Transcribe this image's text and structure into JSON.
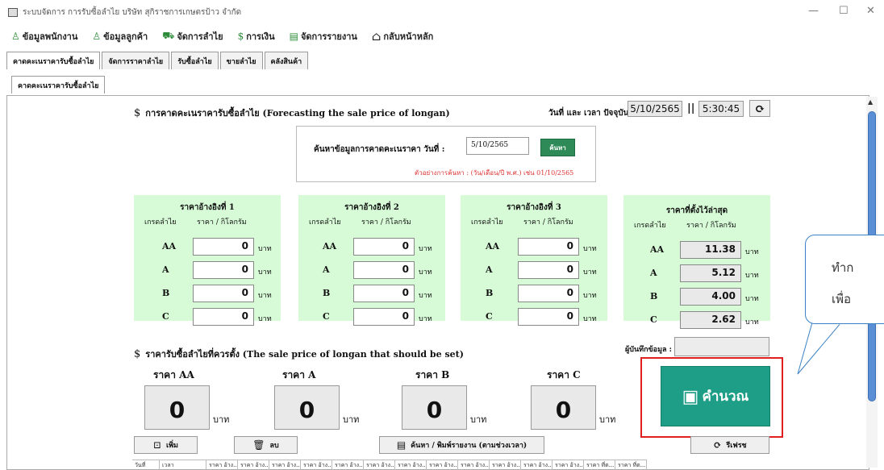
{
  "window": {
    "title": "ระบบจัดการ การรับซื้อลำไย บริษัท สุกิราชการเกษตรป้าว จำกัด",
    "minimize": "—",
    "maximize": "☐",
    "close": "✕"
  },
  "menu": [
    {
      "label": "ข้อมูลพนักงาน",
      "icon": "users-icon",
      "glyph": "♙"
    },
    {
      "label": "ข้อมูลลูกค้า",
      "icon": "customers-icon",
      "glyph": "♙"
    },
    {
      "label": "จัดการลำไย",
      "icon": "cart-icon",
      "glyph": "⛟"
    },
    {
      "label": "การเงิน",
      "icon": "dollar-icon",
      "glyph": "$"
    },
    {
      "label": "จัดการรายงาน",
      "icon": "report-icon",
      "glyph": "▤"
    },
    {
      "label": "กลับหน้าหลัก",
      "icon": "home-icon",
      "glyph": "⌂"
    }
  ],
  "tabs": [
    "คาดคะเนราคารับซื้อลำไย",
    "จัดการราคาลำไย",
    "รับซื้อลำไย",
    "ขายลำไย",
    "คลังสินค้า"
  ],
  "subtab": "คาดคะเนราคารับซื้อลำไย",
  "forecast": {
    "title": "การคาดคะเนราคารับซื้อลำไย (Forecasting the sale price of longan)",
    "datetime_label": "วันที่ และ เวลา ปัจจุบัน :",
    "date": "5/10/2565",
    "separator": "||",
    "time": "5:30:45"
  },
  "search": {
    "label": "ค้นหาข้อมูลการคาดคะเนราคา   วันที่ :",
    "value": "5/10/2565",
    "button": "ค้นหา",
    "hint": "ตัวอย่างการค้นหา : (วัน/เดือน/ปี พ.ศ.) เช่น 01/10/2565"
  },
  "ref_cards": [
    {
      "title": "ราคาอ้างอิงที่ 1",
      "col_grade": "เกรดลำไย",
      "col_price": "ราคา / กิโลกรัม",
      "prices": [
        "0",
        "0",
        "0",
        "0"
      ]
    },
    {
      "title": "ราคาอ้างอิงที่ 2",
      "col_grade": "เกรดลำไย",
      "col_price": "ราคา / กิโลกรัม",
      "prices": [
        "0",
        "0",
        "0",
        "0"
      ]
    },
    {
      "title": "ราคาอ้างอิงที่ 3",
      "col_grade": "เกรดลำไย",
      "col_price": "ราคา / กิโลกรัม",
      "prices": [
        "0",
        "0",
        "0",
        "0"
      ]
    },
    {
      "title": "ราคาที่ตั้งไว้ล่าสุด",
      "col_grade": "เกรดลำไย",
      "col_price": "ราคา / กิโลกรัม",
      "prices": [
        "11.38",
        "5.12",
        "4.00",
        "2.62"
      ]
    }
  ],
  "grades": [
    "AA",
    "A",
    "B",
    "C"
  ],
  "unit": "บาท",
  "set_price": {
    "title": "ราคารับซื้อลำไยที่ควรตั้ง (The sale price of longan that should be set)",
    "recorder_label": "ผู้บันทึกข้อมูล :",
    "labels": [
      "ราคา AA",
      "ราคา A",
      "ราคา B",
      "ราคา C"
    ],
    "values": [
      "0",
      "0",
      "0",
      "0"
    ]
  },
  "calculate_button": "คำนวณ",
  "callout": {
    "line1": "ทำก",
    "line2": "เพื่อ"
  },
  "buttons": {
    "add": "เพิ่ม",
    "delete": "ลบ",
    "search_print": "ค้นหา / พิมพ์รายงาน (ตามช่วงเวลา)",
    "refresh": "รีเฟรช"
  },
  "table_headers": [
    "วันที่",
    "เวลา",
    "ราคา อ้าง...",
    "ราคา อ้าง...",
    "ราคา อ้าง...",
    "ราคา อ้าง...",
    "ราคา อ้าง...",
    "ราคา อ้าง...",
    "ราคา อ้าง...",
    "ราคา อ้าง...",
    "ราคา อ้าง...",
    "ราคา อ้าง...",
    "ราคา อ้าง...",
    "ราคา อ้าง...",
    "ราคา ที่ต...",
    "ราคา ที่ต..."
  ]
}
